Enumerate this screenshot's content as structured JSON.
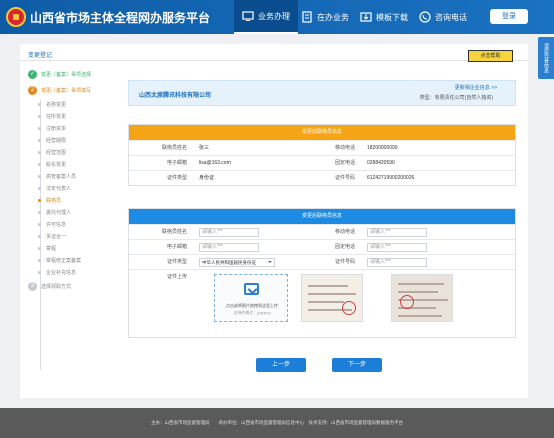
{
  "header": {
    "title": "山西省市场主体全程网办服务平台",
    "nav": [
      {
        "label": "业务办理",
        "icon": "monitor-icon"
      },
      {
        "label": "在办业务",
        "icon": "document-icon"
      },
      {
        "label": "模板下载",
        "icon": "download-icon"
      },
      {
        "label": "咨询电话",
        "icon": "phone-icon"
      }
    ],
    "login": "登录"
  },
  "breadcrumb": "变更登记",
  "help_button": "点击帮助",
  "float_tab": "请您完善信息",
  "sidebar": {
    "steps": [
      {
        "num": "✓",
        "label": "变更（备案）事项选择",
        "state": "done"
      },
      {
        "num": "2",
        "label": "变更（备案）事项填写",
        "state": "current"
      }
    ],
    "subitems": [
      "名称变更",
      "住所变更",
      "注册资本",
      "经营期限",
      "经营范围",
      "股东变更",
      "高管备案人员",
      "法定代表人",
      "联络员",
      "委托代理人",
      "许可信息",
      "多证合一",
      "章程",
      "章程修正案备案",
      "企业补充信息"
    ],
    "active_sub": 8,
    "last_step": {
      "num": "3",
      "label": "选择领取方式"
    }
  },
  "company": {
    "name": "山西太原腾讯科技有限公司",
    "link": "更新相企业信息 >>",
    "type_label": "类型：",
    "type_value": "有限责任公司(自然人独资)"
  },
  "before": {
    "title": "变更前联络员信息",
    "rows": [
      [
        "联络员姓名",
        "张三",
        "移动电话",
        "18200000000"
      ],
      [
        "电子邮箱",
        "lisa@163.com",
        "固定电话",
        "0288420590"
      ],
      [
        "证件类型",
        "身份证",
        "证件号码",
        "61242719900200026"
      ]
    ]
  },
  "after": {
    "title": "变更后联络员信息",
    "name_label": "联络员姓名",
    "name_ph": "请输入***",
    "mobile_label": "移动电话",
    "mobile_ph": "请输入***",
    "email_label": "电子邮箱",
    "email_ph": "请输入***",
    "phone_label": "固定电话",
    "phone_ph": "请输入***",
    "idtype_label": "证件类型",
    "idtype_value": "中华人民共和国居民身份证",
    "idno_label": "证件号码",
    "idno_ph": "请输入***",
    "upload_label": "证件上传",
    "upload_line1": "点击或将图片拖拽到这里上传",
    "upload_line2": "支持的格式：jpg/png"
  },
  "buttons": {
    "prev": "上一步",
    "next": "下一步"
  },
  "footer": {
    "text": "主办：山西省市场监督管理局　　承办单位：山西省市场监督管理局信息中心　技术支持：山西省市场监督管理局数据服务平台"
  }
}
